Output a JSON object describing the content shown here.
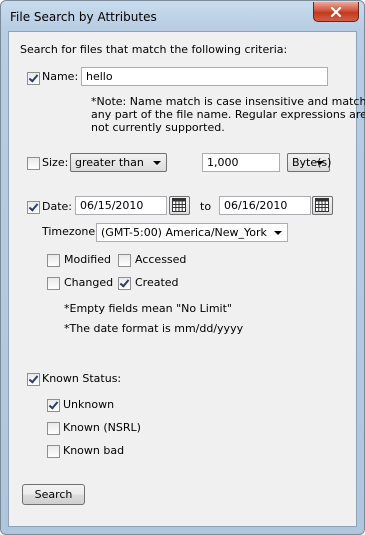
{
  "window": {
    "title": "File Search by Attributes"
  },
  "intro": "Search for files that match the following criteria:",
  "name": {
    "checked": true,
    "label": "Name:",
    "value": "hello",
    "note_line1": "*Note: Name match is case insensitive and matches",
    "note_line2": "any part of the file name. Regular expressions are",
    "note_line3": "not currently supported."
  },
  "size": {
    "checked": false,
    "label": "Size:",
    "comparator": "greater than",
    "value": "1,000",
    "unit": "Byte(s)"
  },
  "date": {
    "checked": true,
    "label": "Date:",
    "from": "06/15/2010",
    "to_label": "to",
    "to": "06/16/2010",
    "timezone_label": "Timezone:",
    "timezone": "(GMT-5:00) America/New_York",
    "options": {
      "modified": {
        "label": "Modified",
        "checked": false
      },
      "accessed": {
        "label": "Accessed",
        "checked": false
      },
      "changed": {
        "label": "Changed",
        "checked": false
      },
      "created": {
        "label": "Created",
        "checked": true
      }
    },
    "hint1": "*Empty fields mean \"No Limit\"",
    "hint2": "*The date format is mm/dd/yyyy"
  },
  "known_status": {
    "checked": true,
    "label": "Known Status:",
    "options": {
      "unknown": {
        "label": "Unknown",
        "checked": true
      },
      "known_nsrl": {
        "label": "Known (NSRL)",
        "checked": false
      },
      "known_bad": {
        "label": "Known bad",
        "checked": false
      }
    }
  },
  "search_button": "Search",
  "icons": {
    "close": "close-icon",
    "calendar": "calendar-icon",
    "dropdown": "chevron-down-icon"
  }
}
